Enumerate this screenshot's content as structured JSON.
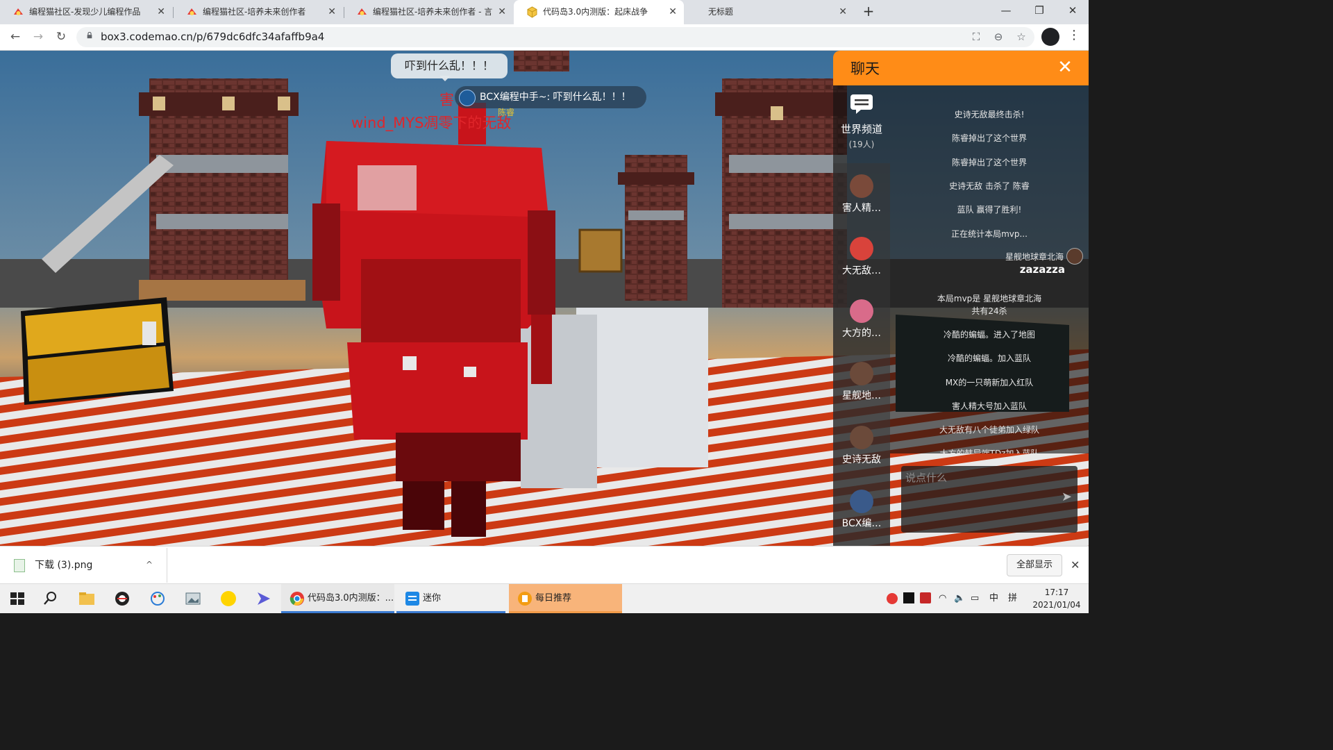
{
  "browser": {
    "tabs": [
      {
        "title": "编程猫社区-发现少儿编程作品",
        "active": false
      },
      {
        "title": "编程猫社区-培养未来创作者",
        "active": false
      },
      {
        "title": "编程猫社区-培养未来创作者 - 言",
        "active": false
      },
      {
        "title": "代码岛3.0内测版：起床战争",
        "active": true
      },
      {
        "title": "无标题",
        "active": false
      }
    ],
    "tab_close_glyph": "✕",
    "new_tab_glyph": "+",
    "url": "box3.codemao.cn/p/679dc6dfc34afaffb9a4",
    "window_controls": {
      "minimize": "—",
      "maximize": "❐",
      "close": "✕"
    }
  },
  "game": {
    "speech_bubble": "吓到什么乱！！！",
    "killfeed": "BCX编程中手~: 吓到什么乱！！！",
    "red_overlay_1": "害",
    "red_overlay_2": "wind_MYS凋零下的无敌",
    "gold_name": "陈睿"
  },
  "chat": {
    "title": "聊天",
    "close_glyph": "✕",
    "channel": {
      "name": "世界频道",
      "count": "(19人)"
    },
    "players": [
      {
        "name": "害人精…",
        "avatar_color": "#7a4a3a"
      },
      {
        "name": "大无敌…",
        "avatar_color": "#d9433b"
      },
      {
        "name": "大方的…",
        "avatar_color": "#d96b8a"
      },
      {
        "name": "星舰地…",
        "avatar_color": "#6b4a3a"
      },
      {
        "name": "史诗无敌",
        "avatar_color": "#6b4a3a"
      },
      {
        "name": "BCX编…",
        "avatar_color": "#3a5a8a"
      }
    ],
    "messages": [
      "史诗无敌最终击杀!",
      "陈睿掉出了这个世界",
      "陈睿掉出了这个世界",
      "史诗无敌 击杀了 陈睿",
      "蓝队 赢得了胜利!",
      "正在统计本局mvp..."
    ],
    "user_message": {
      "sender": "星舰地球章北海",
      "text": "zazazza"
    },
    "messages_after": [
      "本局mvp是 星舰地球章北海",
      "共有24杀",
      "冷酷的蝙蝠。进入了地图",
      "冷酷的蝙蝠。加入蓝队",
      "MX的一只萌新加入红队",
      "害人精大号加入蓝队",
      "大无敌有八个徒弟加入绿队",
      "大方的韩异端TDz加入蓝队"
    ],
    "input_placeholder": "说点什么",
    "send_glyph": "➤"
  },
  "downloads": {
    "file_name": "下载 (3).png",
    "caret_glyph": "^",
    "show_all": "全部显示",
    "close_glyph": "✕"
  },
  "taskbar": {
    "buttons": [
      {
        "label": "代码岛3.0内测版：...",
        "accent": "#3b7bd1",
        "icon_color": "#e53935"
      },
      {
        "label": "迷你",
        "accent": "#3b7bd1",
        "icon_color": "#1e88e5"
      },
      {
        "label": "每日推荐",
        "accent": "#f39c4a",
        "icon_color": "#f39c12"
      }
    ],
    "ime": "中",
    "ime2": "拼",
    "time": "17:17",
    "date": "2021/01/04"
  }
}
